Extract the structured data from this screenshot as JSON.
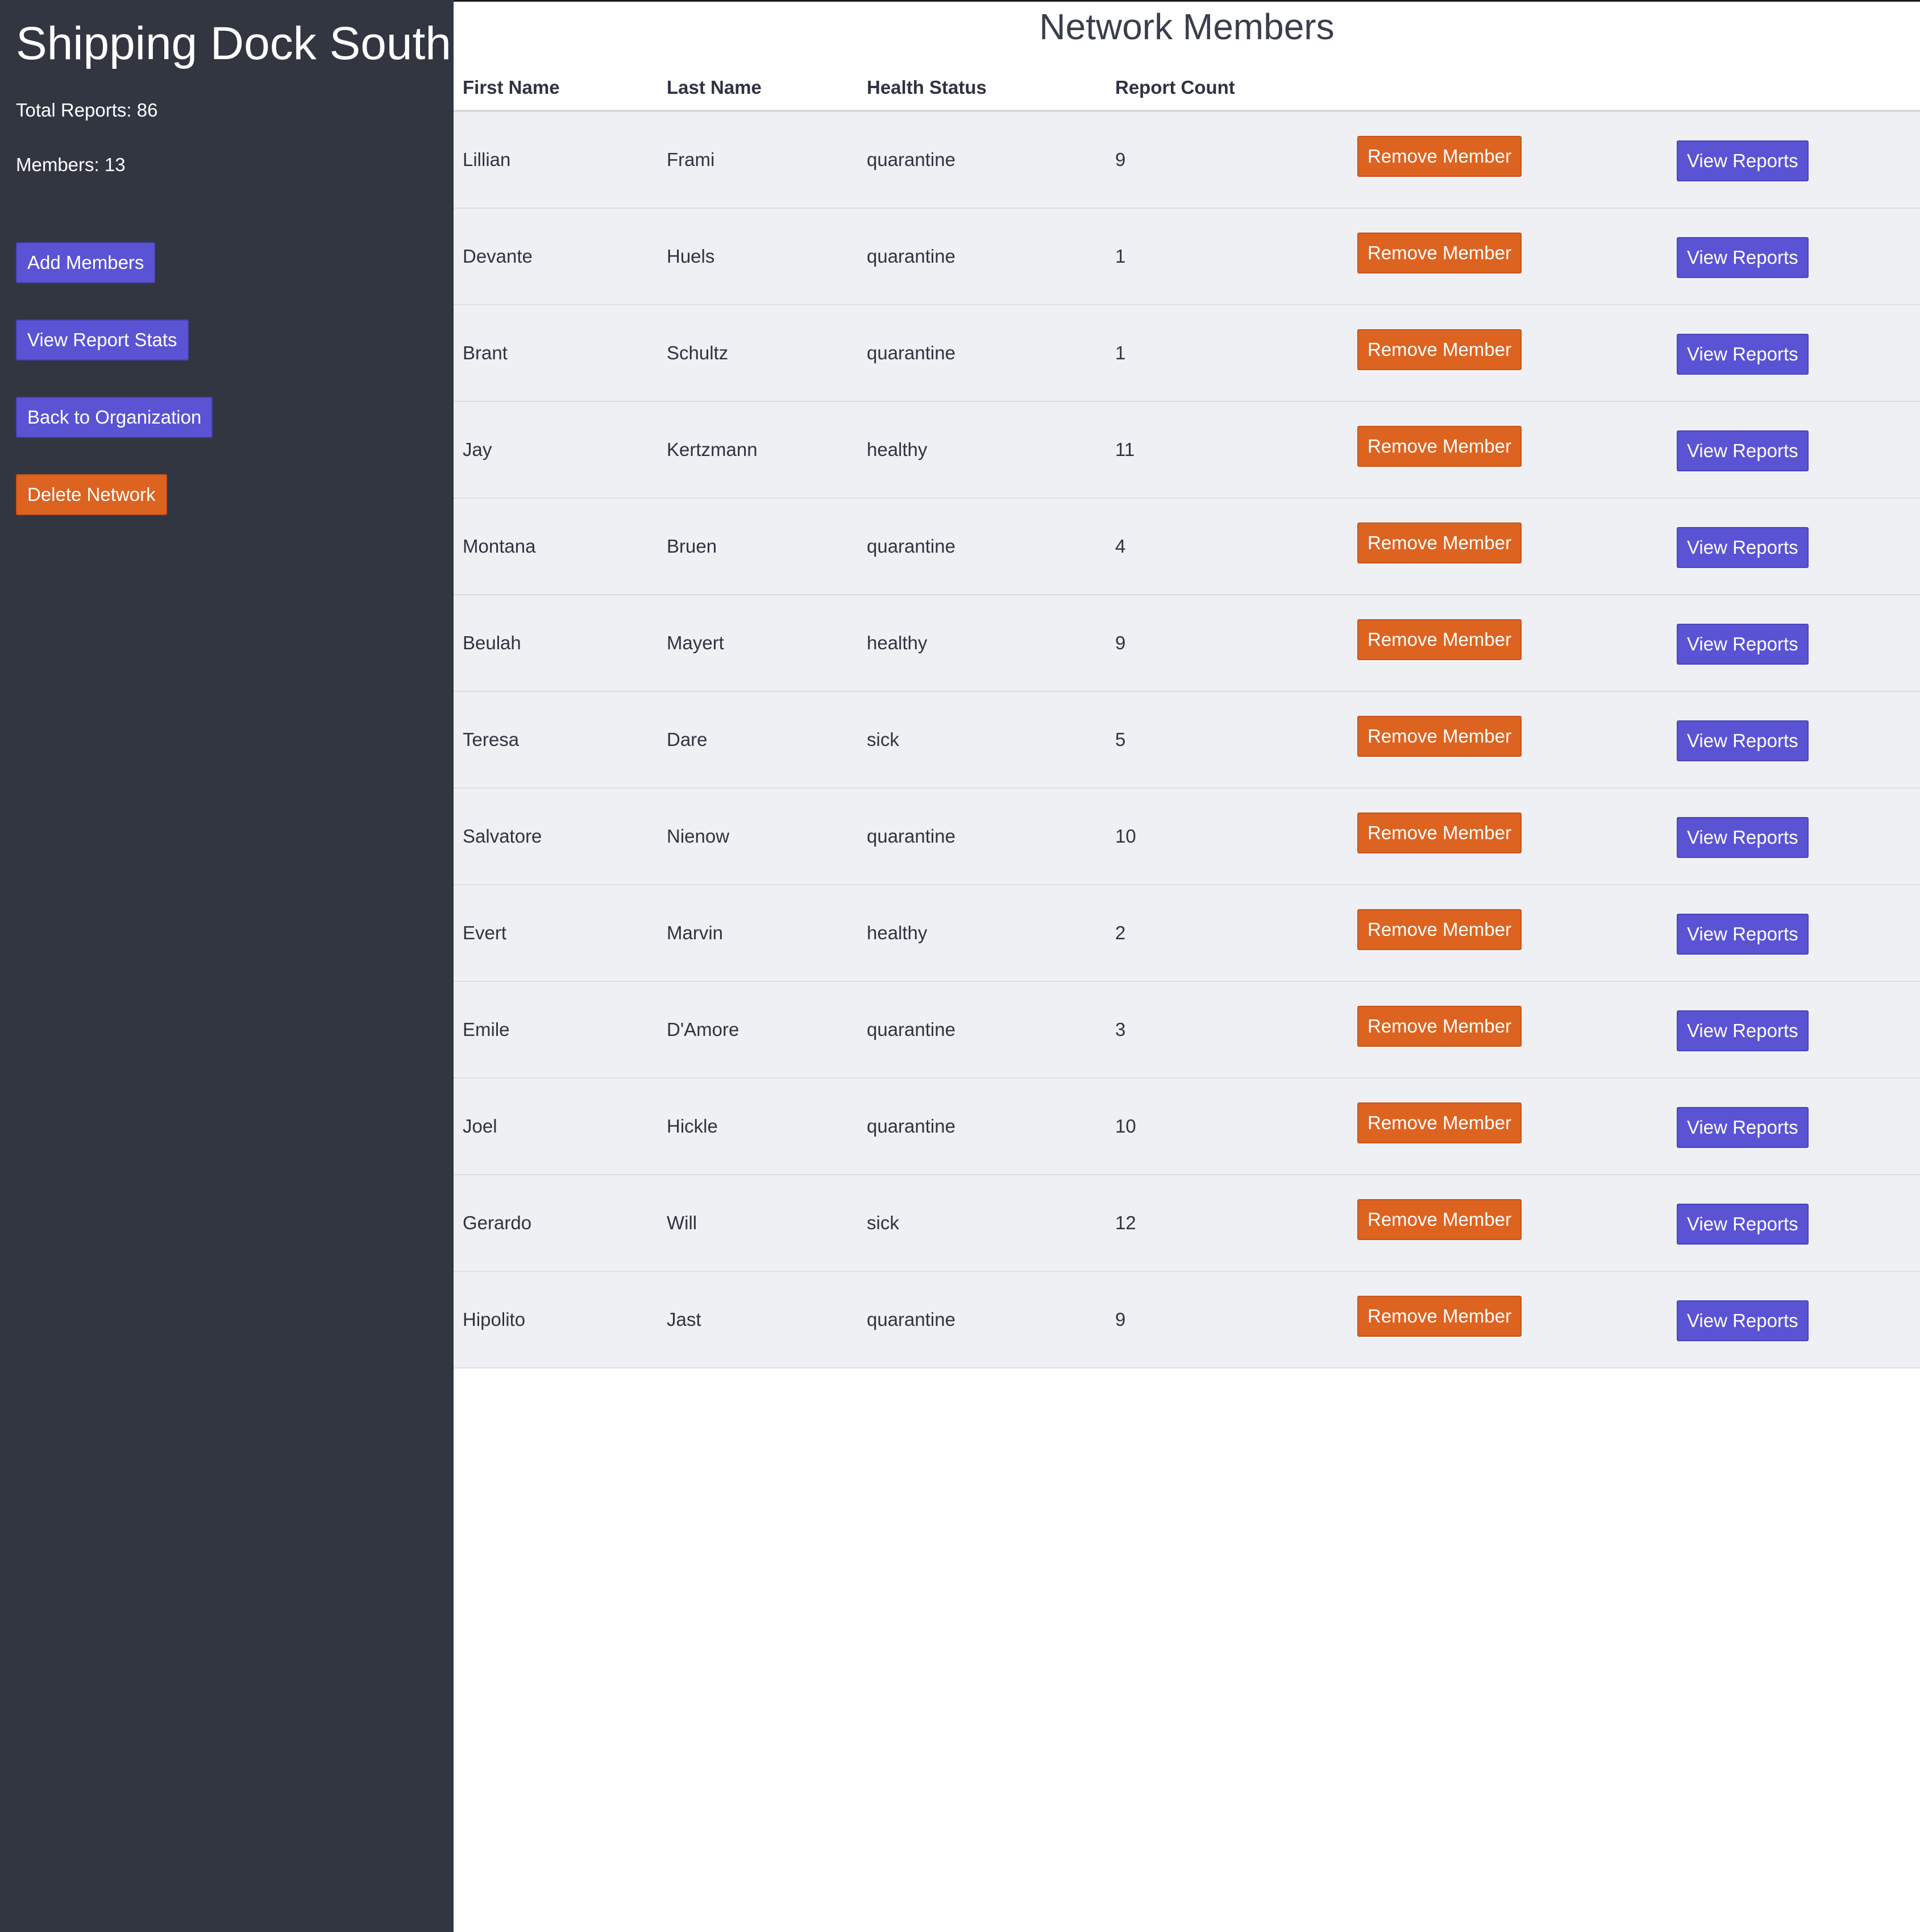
{
  "sidebar": {
    "title": "Shipping Dock South",
    "total_reports": "Total Reports: 86",
    "members": "Members: 13",
    "buttons": {
      "add_members": "Add Members",
      "view_report_stats": "View Report Stats",
      "back_to_org": "Back to Organization",
      "delete_network": "Delete Network"
    }
  },
  "main": {
    "title": "Network Members",
    "columns": [
      "First Name",
      "Last Name",
      "Health Status",
      "Report Count"
    ],
    "remove_label": "Remove Member",
    "view_label": "View Reports",
    "rows": [
      {
        "first": "Lillian",
        "last": "Frami",
        "health": "quarantine",
        "count": "9"
      },
      {
        "first": "Devante",
        "last": "Huels",
        "health": "quarantine",
        "count": "1"
      },
      {
        "first": "Brant",
        "last": "Schultz",
        "health": "quarantine",
        "count": "1"
      },
      {
        "first": "Jay",
        "last": "Kertzmann",
        "health": "healthy",
        "count": "11"
      },
      {
        "first": "Montana",
        "last": "Bruen",
        "health": "quarantine",
        "count": "4"
      },
      {
        "first": "Beulah",
        "last": "Mayert",
        "health": "healthy",
        "count": "9"
      },
      {
        "first": "Teresa",
        "last": "Dare",
        "health": "sick",
        "count": "5"
      },
      {
        "first": "Salvatore",
        "last": "Nienow",
        "health": "quarantine",
        "count": "10"
      },
      {
        "first": "Evert",
        "last": "Marvin",
        "health": "healthy",
        "count": "2"
      },
      {
        "first": "Emile",
        "last": "D'Amore",
        "health": "quarantine",
        "count": "3"
      },
      {
        "first": "Joel",
        "last": "Hickle",
        "health": "quarantine",
        "count": "10"
      },
      {
        "first": "Gerardo",
        "last": "Will",
        "health": "sick",
        "count": "12"
      },
      {
        "first": "Hipolito",
        "last": "Jast",
        "health": "quarantine",
        "count": "9"
      }
    ]
  },
  "colors": {
    "sidebar_bg": "#323641",
    "primary_button": "#5a53d4",
    "danger_button": "#dd6320",
    "row_bg": "#eff0f4"
  }
}
